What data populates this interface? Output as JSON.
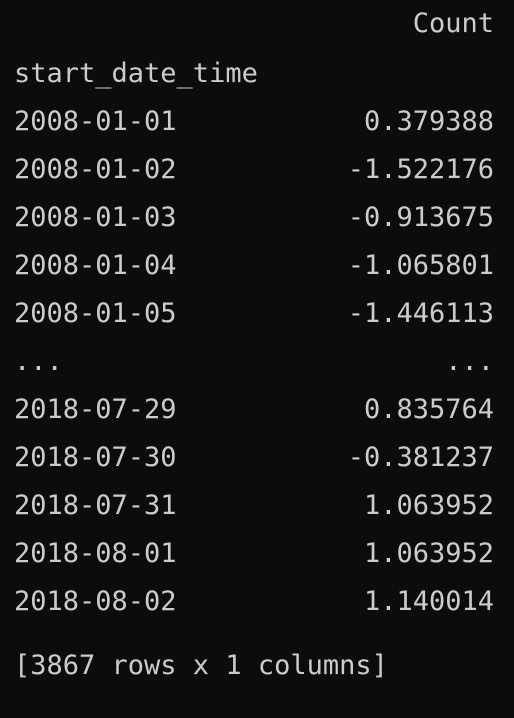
{
  "dataframe": {
    "column_header": "Count",
    "index_name": "start_date_time",
    "rows": [
      {
        "index": "2008-01-01",
        "value": "0.379388"
      },
      {
        "index": "2008-01-02",
        "value": "-1.522176"
      },
      {
        "index": "2008-01-03",
        "value": "-0.913675"
      },
      {
        "index": "2008-01-04",
        "value": "-1.065801"
      },
      {
        "index": "2008-01-05",
        "value": "-1.446113"
      },
      {
        "index": "...",
        "value": "..."
      },
      {
        "index": "2018-07-29",
        "value": "0.835764"
      },
      {
        "index": "2018-07-30",
        "value": "-0.381237"
      },
      {
        "index": "2018-07-31",
        "value": "1.063952"
      },
      {
        "index": "2018-08-01",
        "value": "1.063952"
      },
      {
        "index": "2018-08-02",
        "value": "1.140014"
      }
    ],
    "summary": "[3867 rows x 1 columns]"
  }
}
